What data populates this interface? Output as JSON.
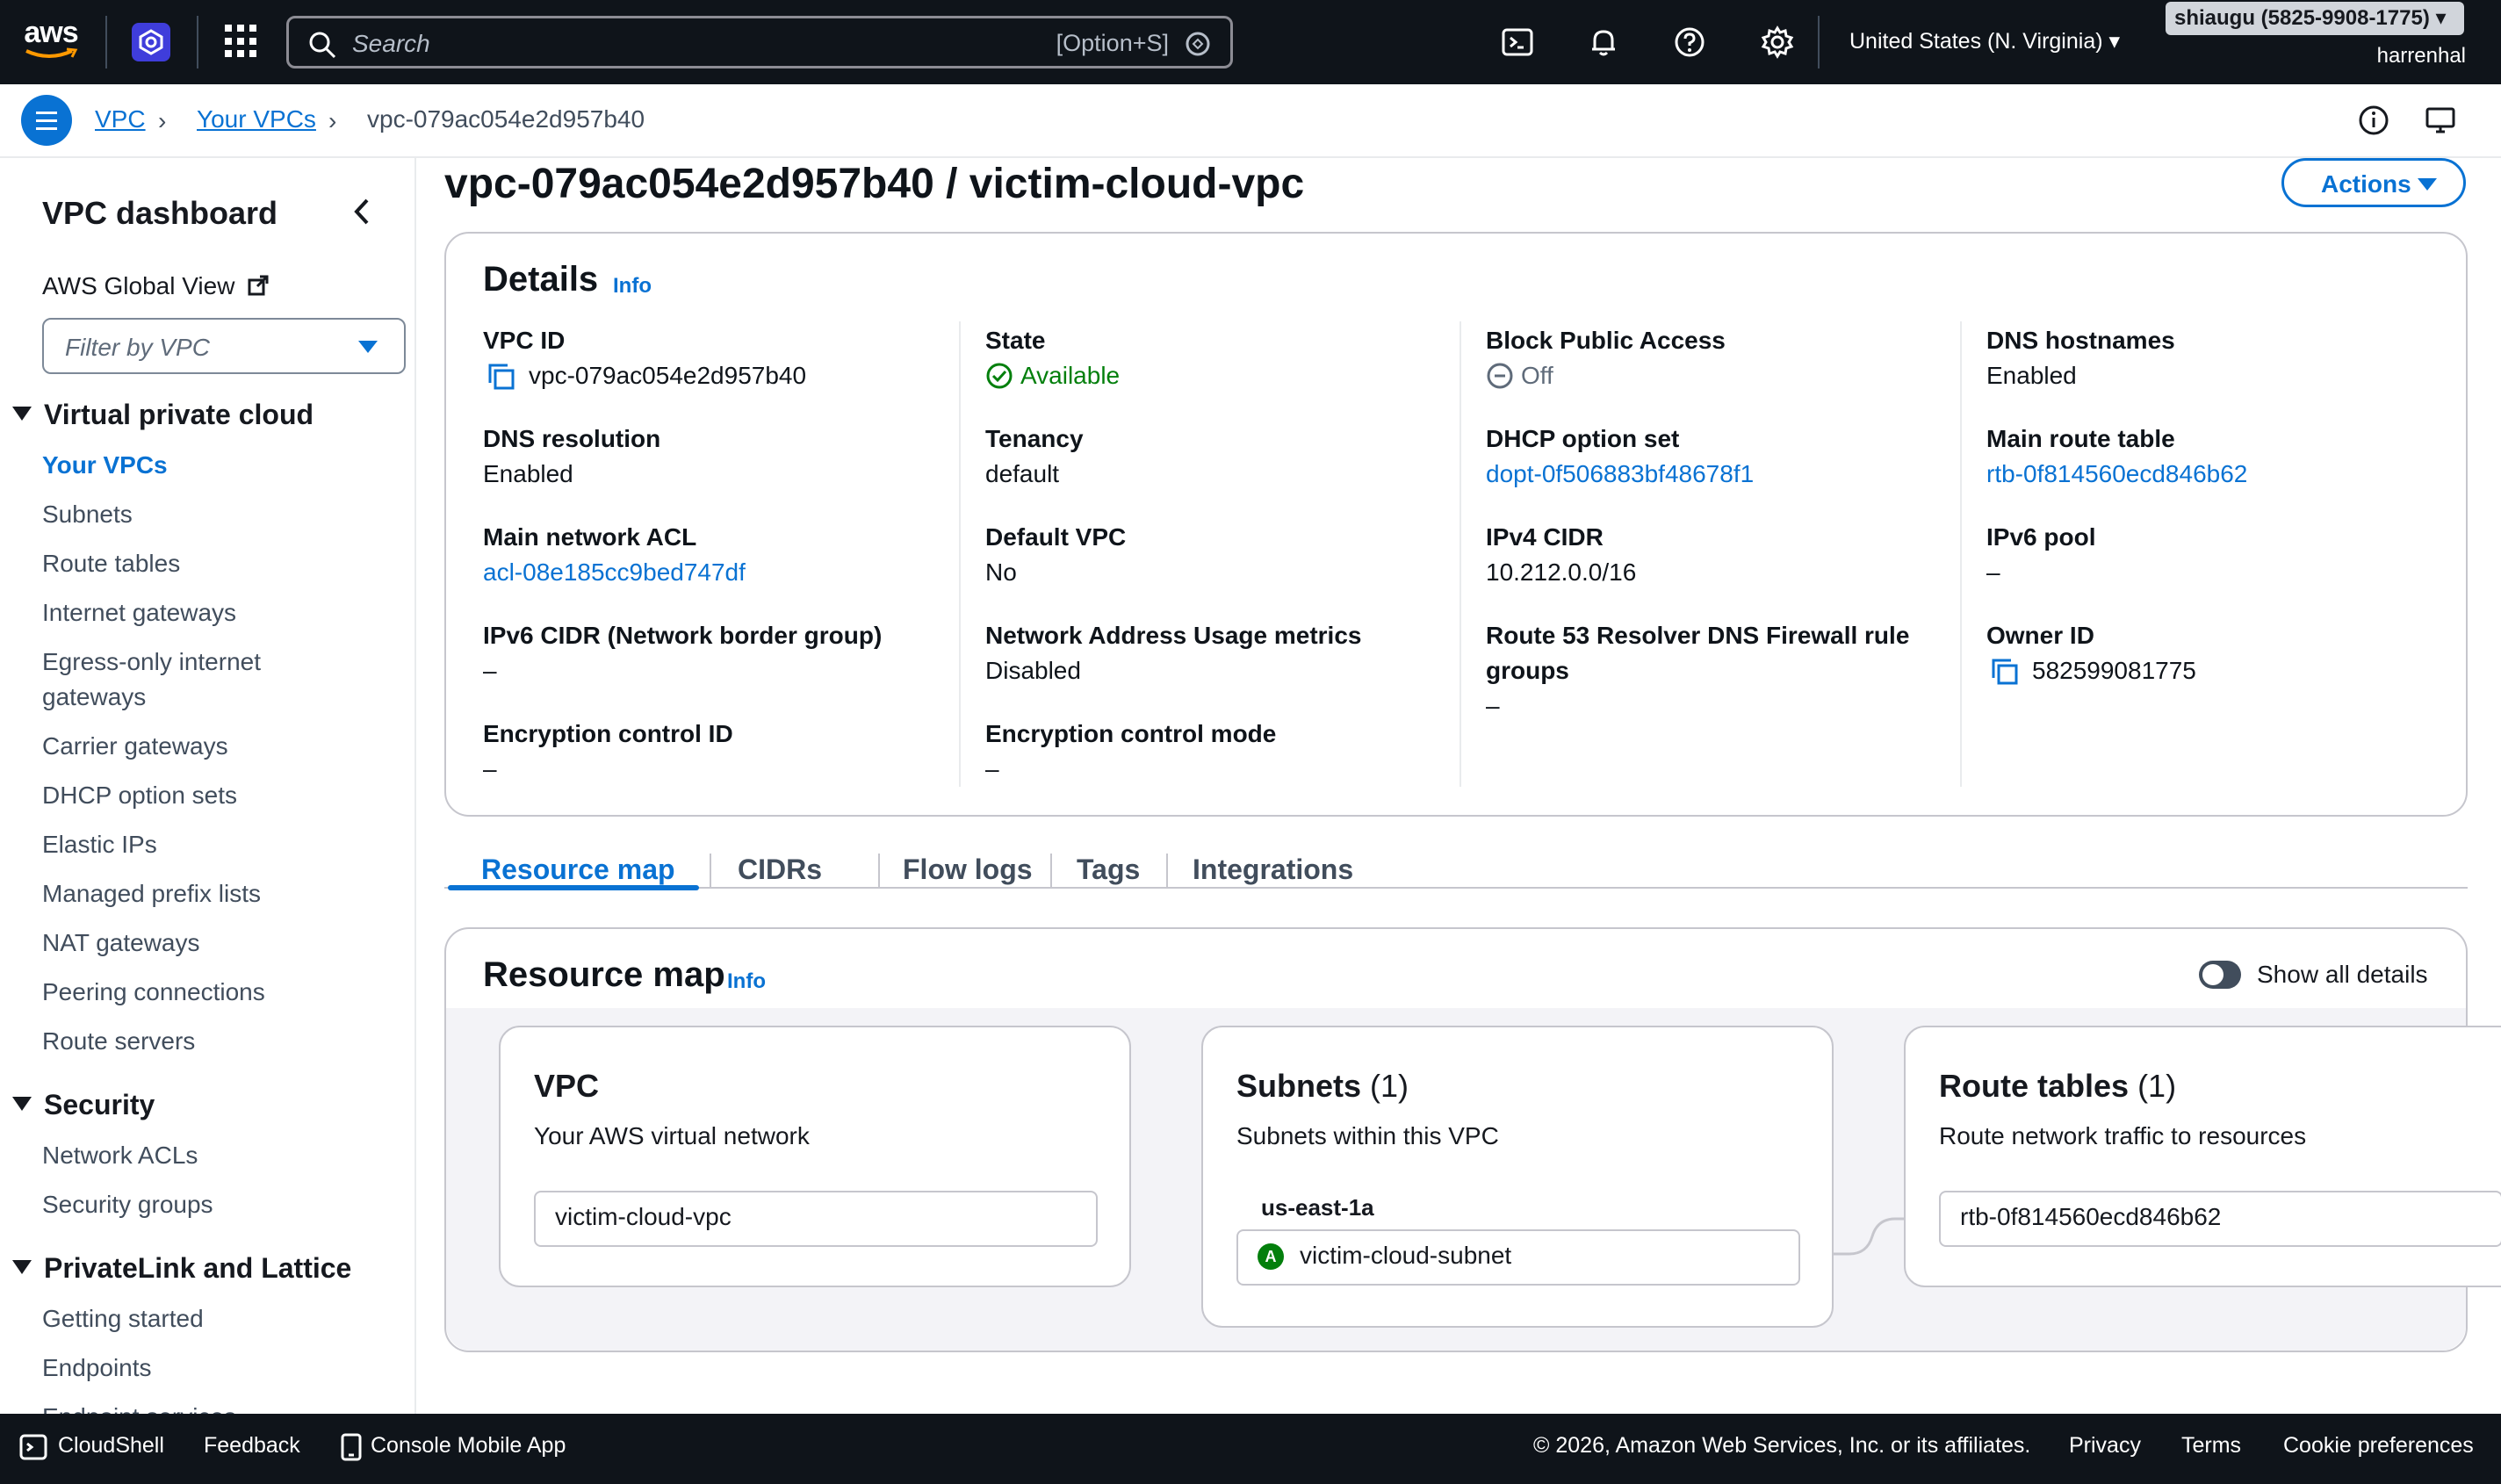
{
  "topnav": {
    "logo_text": "aws",
    "search_placeholder": "Search",
    "search_shortcut": "[Option+S]",
    "region": "United States (N. Virginia) ▾",
    "account": "shiaugu (5825-9908-1775) ▾",
    "user": "harrenhal"
  },
  "breadcrumb": {
    "items": [
      "VPC",
      "Your VPCs",
      "vpc-079ac054e2d957b40"
    ]
  },
  "sidebar": {
    "title": "VPC dashboard",
    "global_view": "AWS Global View",
    "filter_placeholder": "Filter by VPC",
    "sections": [
      {
        "title": "Virtual private cloud",
        "items": [
          "Your VPCs",
          "Subnets",
          "Route tables",
          "Internet gateways",
          "Egress-only internet gateways",
          "Carrier gateways",
          "DHCP option sets",
          "Elastic IPs",
          "Managed prefix lists",
          "NAT gateways",
          "Peering connections",
          "Route servers"
        ]
      },
      {
        "title": "Security",
        "items": [
          "Network ACLs",
          "Security groups"
        ]
      },
      {
        "title": "PrivateLink and Lattice",
        "items": [
          "Getting started",
          "Endpoints",
          "Endpoint services"
        ]
      }
    ]
  },
  "main": {
    "title": "vpc-079ac054e2d957b40 / victim-cloud-vpc",
    "actions_label": "Actions",
    "details": {
      "heading": "Details",
      "info": "Info",
      "fields": {
        "vpc_id": {
          "label": "VPC ID",
          "value": "vpc-079ac054e2d957b40"
        },
        "state": {
          "label": "State",
          "value": "Available"
        },
        "block_public_access": {
          "label": "Block Public Access",
          "value": "Off"
        },
        "dns_hostnames": {
          "label": "DNS hostnames",
          "value": "Enabled"
        },
        "dns_resolution": {
          "label": "DNS resolution",
          "value": "Enabled"
        },
        "tenancy": {
          "label": "Tenancy",
          "value": "default"
        },
        "dhcp_option_set": {
          "label": "DHCP option set",
          "value": "dopt-0f506883bf48678f1"
        },
        "main_route_table": {
          "label": "Main route table",
          "value": "rtb-0f814560ecd846b62"
        },
        "main_network_acl": {
          "label": "Main network ACL",
          "value": "acl-08e185cc9bed747df"
        },
        "default_vpc": {
          "label": "Default VPC",
          "value": "No"
        },
        "ipv4_cidr": {
          "label": "IPv4 CIDR",
          "value": "10.212.0.0/16"
        },
        "ipv6_pool": {
          "label": "IPv6 pool",
          "value": "–"
        },
        "ipv6_cidr": {
          "label": "IPv6 CIDR (Network border group)",
          "value": "–"
        },
        "nau_metrics": {
          "label": "Network Address Usage metrics",
          "value": "Disabled"
        },
        "route53_firewall": {
          "label_line1": "Route 53 Resolver DNS Firewall rule",
          "label_line2": "groups",
          "value": "–"
        },
        "owner_id": {
          "label": "Owner ID",
          "value": "582599081775"
        },
        "encryption_control_id": {
          "label": "Encryption control ID",
          "value": "–"
        },
        "encryption_control_mode": {
          "label": "Encryption control mode",
          "value": "–"
        }
      }
    },
    "tabs": [
      "Resource map",
      "CIDRs",
      "Flow logs",
      "Tags",
      "Integrations"
    ],
    "resource_map": {
      "heading": "Resource map",
      "info": "Info",
      "toggle_label": "Show all details",
      "toggle_on": false,
      "vpc_card": {
        "title": "VPC",
        "subtitle": "Your AWS virtual network",
        "resource": "victim-cloud-vpc"
      },
      "subnets_card": {
        "title": "Subnets",
        "count": "(1)",
        "subtitle": "Subnets within this VPC",
        "az": "us-east-1a",
        "az_badge": "A",
        "resource": "victim-cloud-subnet"
      },
      "route_tables_card": {
        "title": "Route tables",
        "count": "(1)",
        "subtitle": "Route network traffic to resources",
        "resource": "rtb-0f814560ecd846b62"
      }
    }
  },
  "footer": {
    "cloudshell": "CloudShell",
    "feedback": "Feedback",
    "mobile_app": "Console Mobile App",
    "copyright": "© 2026, Amazon Web Services, Inc. or its affiliates.",
    "privacy": "Privacy",
    "terms": "Terms",
    "cookies": "Cookie preferences"
  },
  "colors": {
    "nav_bg": "#0f141a",
    "link": "#0972d3",
    "success": "#037f0c",
    "border": "#c6c6cd"
  }
}
